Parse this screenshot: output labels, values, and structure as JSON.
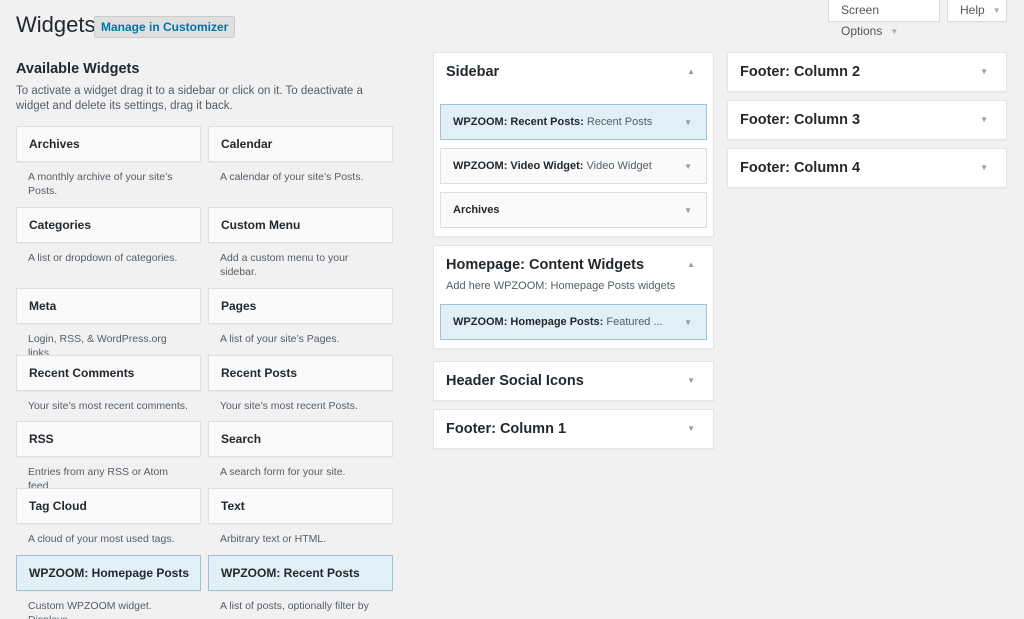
{
  "header": {
    "title": "Widgets",
    "customize_btn": "Manage in Customizer",
    "screen_options": "Screen Options",
    "help": "Help",
    "arrow_down": "▼",
    "arrow_up": "▲"
  },
  "available": {
    "title": "Available Widgets",
    "description": "To activate a widget drag it to a sidebar or click on it. To deactivate a widget and delete its settings, drag it back.",
    "widgets": [
      {
        "name": "Archives",
        "desc": "A monthly archive of your site’s Posts."
      },
      {
        "name": "Calendar",
        "desc": "A calendar of your site’s Posts."
      },
      {
        "name": "Categories",
        "desc": "A list or dropdown of categories."
      },
      {
        "name": "Custom Menu",
        "desc": "Add a custom menu to your sidebar."
      },
      {
        "name": "Meta",
        "desc": "Login, RSS, & WordPress.org links."
      },
      {
        "name": "Pages",
        "desc": "A list of your site’s Pages."
      },
      {
        "name": "Recent Comments",
        "desc": "Your site’s most recent comments."
      },
      {
        "name": "Recent Posts",
        "desc": "Your site’s most recent Posts."
      },
      {
        "name": "RSS",
        "desc": "Entries from any RSS or Atom feed."
      },
      {
        "name": "Search",
        "desc": "A search form for your site."
      },
      {
        "name": "Tag Cloud",
        "desc": "A cloud of your most used tags."
      },
      {
        "name": "Text",
        "desc": "Arbitrary text or HTML."
      },
      {
        "name": "WPZOOM: Homepage Posts",
        "desc": "Custom WPZOOM widget. Displays"
      },
      {
        "name": "WPZOOM: Recent Posts",
        "desc": "A list of posts, optionally filter by"
      }
    ]
  },
  "areas": {
    "sidebar": {
      "title": "Sidebar",
      "widgets": [
        {
          "name": "WPZOOM: Recent Posts:",
          "sub": " Recent Posts"
        },
        {
          "name": "WPZOOM: Video Widget:",
          "sub": " Video Widget"
        },
        {
          "name": "Archives",
          "sub": ""
        }
      ]
    },
    "homepage": {
      "title": "Homepage: Content Widgets",
      "desc": "Add here WPZOOM: Homepage Posts widgets",
      "widgets": [
        {
          "name": "WPZOOM: Homepage Posts:",
          "sub": " Featured ..."
        }
      ]
    },
    "header_social": {
      "title": "Header Social Icons"
    },
    "footer1": {
      "title": "Footer: Column 1"
    },
    "footer2": {
      "title": "Footer: Column 2"
    },
    "footer3": {
      "title": "Footer: Column 3"
    },
    "footer4": {
      "title": "Footer: Column 4"
    }
  }
}
